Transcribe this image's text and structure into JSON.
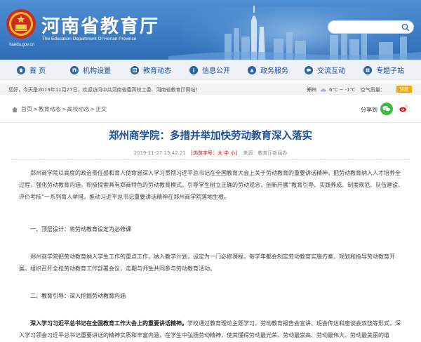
{
  "header": {
    "site_title": "河南省教育厅",
    "site_subtitle": "The Education Department Of Henan Province",
    "logo_url_text": "haedu.gov.cn",
    "search_placeholder": ""
  },
  "nav": {
    "items": [
      {
        "label": "首 页",
        "icon": "home-icon"
      },
      {
        "label": "机构设置",
        "icon": "org-icon"
      },
      {
        "label": "教育动态",
        "icon": "news-icon"
      },
      {
        "label": "信息公开",
        "icon": "info-icon"
      },
      {
        "label": "政务服务",
        "icon": "service-icon"
      },
      {
        "label": "交流互动",
        "icon": "chat-icon"
      },
      {
        "label": "专题子站",
        "icon": "topic-icon"
      }
    ]
  },
  "infobar": {
    "welcome": "您好，今天是2019年11月27日，欢迎访问中共河南省委高校工委、河南省教育厅网站！",
    "city": "郑州",
    "temperature": "6℃ ~ -1℃",
    "air_quality_label": "空气质量：",
    "air_quality_value": "轻度"
  },
  "breadcrumb": {
    "items": [
      "首页",
      "教育动态",
      "高校动态",
      "正文"
    ]
  },
  "share": {
    "label": "分享到"
  },
  "article": {
    "title": "郑州商学院：多措并举加快劳动教育深入落实",
    "datetime": "2019-11-27 15:42:21",
    "font_label": "[浏览字号：",
    "font_large": "大",
    "font_medium": "中",
    "font_small": "小",
    "font_end": "]",
    "source": "来源：教育厅新闻办",
    "p1": "郑州商学院以高度的政治责任感和育人使命感深入学习贯彻习近平总书记在全国教育大会上关于劳动教育的重要讲话精神，把劳动教育纳入人才培养全过程，强化劳动教育内涵，积极探索具有郑商特色的劳动教育模式，引导学生树立正确的劳动观念，创新开展“教育引导、实践养成、制度规范、队伍建设、评价考核”一系列育人举措，推动习近平总书记重要讲话精神在郑州商学院落地生根。",
    "h1": "一、顶层设计：将劳动教育设定为必修课",
    "p2": "郑州商学院把劳动教育纳入学生工作的重点工作，纳入教学计划，设定为一门必修课程，每学年都会制定劳动教育实施方案，规划和指导劳动教育开展。组织召开全校劳动教育工作部署会议，走期与师生共同参与劳动教育活动。",
    "h2": "二、教育引导：深入挖掘劳动教育内涵",
    "p3_bold": "深入学习习近平总书记在全国教育工作大会上的重要讲话精神。",
    "p3_rest": "学校通过教育理论主题学习、劳动教育报告会宣讲、班会传达和座谈会双饶等形式，深入学习领会习近平总书记重要讲话的精神实质和丰富内涵，在学生中弘扬劳动精神，使其懂得劳动最光荣、劳动最崇高、劳动最伟大、劳动最美丽的道"
  },
  "colors": {
    "header_blue": "#3c7dc4",
    "nav_text": "#1d4f8f",
    "title_blue": "#1e4f93",
    "meta_red": "#cc0000",
    "aqi_orange": "#f5a800",
    "wechat_green": "#3dbb44"
  }
}
